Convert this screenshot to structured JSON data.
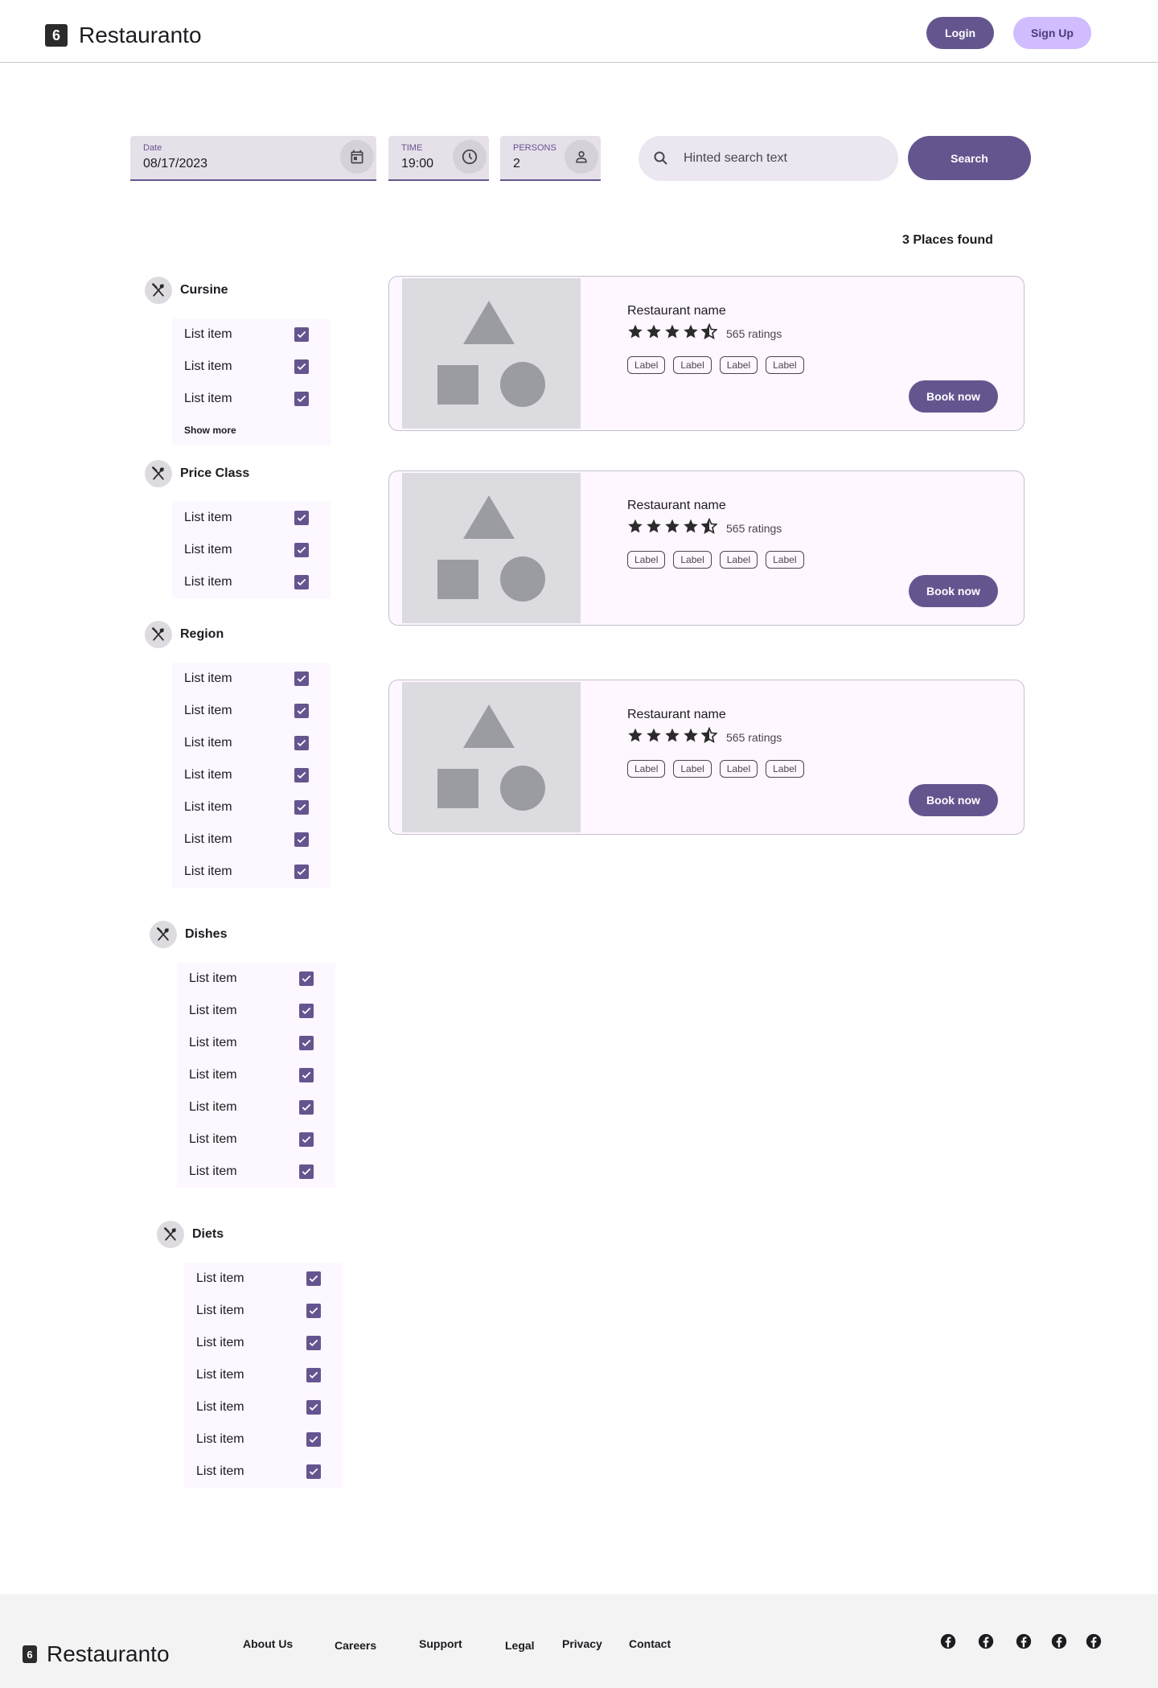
{
  "header": {
    "brand": "Restauranto",
    "logo_glyph": "6",
    "login_label": "Login",
    "signup_label": "Sign Up"
  },
  "search": {
    "date_label": "Date",
    "date_value": "08/17/2023",
    "time_label": "TIME",
    "time_value": "19:00",
    "persons_label": "PERSONS",
    "persons_value": "2",
    "placeholder": "Hinted search text",
    "button_label": "Search"
  },
  "results": {
    "count_text": "3 Places found"
  },
  "filters": [
    {
      "title": "Cursine",
      "items": [
        "List item",
        "List item",
        "List item"
      ],
      "show_more": "Show more"
    },
    {
      "title": "Price Class",
      "items": [
        "List item",
        "List item",
        "List item"
      ]
    },
    {
      "title": "Region",
      "items": [
        "List item",
        "List item",
        "List item",
        "List item",
        "List item",
        "List item",
        "List item"
      ]
    },
    {
      "title": "Dishes",
      "items": [
        "List item",
        "List item",
        "List item",
        "List item",
        "List item",
        "List item",
        "List item"
      ]
    },
    {
      "title": "Diets",
      "items": [
        "List item",
        "List item",
        "List item",
        "List item",
        "List item",
        "List item",
        "List item"
      ]
    }
  ],
  "cards": [
    {
      "name": "Restaurant name",
      "rating": 4.5,
      "ratings_text": "565 ratings",
      "labels": [
        "Label",
        "Label",
        "Label",
        "Label"
      ],
      "book_label": "Book now"
    },
    {
      "name": "Restaurant name",
      "rating": 4.5,
      "ratings_text": "565 ratings",
      "labels": [
        "Label",
        "Label",
        "Label",
        "Label"
      ],
      "book_label": "Book now"
    },
    {
      "name": "Restaurant name",
      "rating": 4.5,
      "ratings_text": "565 ratings",
      "labels": [
        "Label",
        "Label",
        "Label",
        "Label"
      ],
      "book_label": "Book now"
    }
  ],
  "footer": {
    "brand": "Restauranto",
    "links": [
      "About Us",
      "Careers",
      "Support",
      "Legal",
      "Privacy",
      "Contact"
    ],
    "social_icons": [
      "facebook-icon",
      "facebook-icon",
      "facebook-icon",
      "facebook-icon",
      "facebook-icon"
    ]
  },
  "colors": {
    "primary": "#65558f",
    "secondary": "#d0bcff",
    "surface": "#fef7ff",
    "field": "#e6e0e9"
  }
}
